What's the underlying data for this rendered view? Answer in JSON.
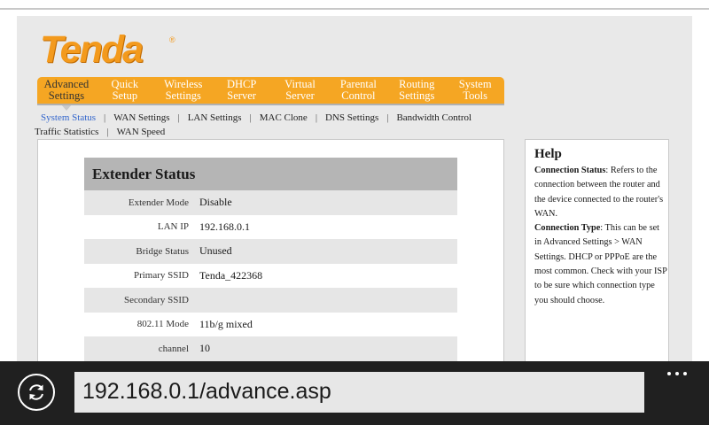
{
  "brand": {
    "logo_text": "Tenda",
    "logo_reg": "®",
    "accent": "#f5a623"
  },
  "menu": [
    {
      "label": "Advanced\nSettings",
      "active": true
    },
    {
      "label": "Quick\nSetup"
    },
    {
      "label": "Wireless\nSettings"
    },
    {
      "label": "DHCP\nServer"
    },
    {
      "label": "Virtual\nServer"
    },
    {
      "label": "Parental\nControl"
    },
    {
      "label": "Routing\nSettings"
    },
    {
      "label": "System\nTools"
    }
  ],
  "submenu": {
    "line1": [
      "System Status",
      "WAN Settings",
      "LAN Settings",
      "MAC Clone",
      "DNS Settings",
      "Bandwidth Control"
    ],
    "line2": [
      "Traffic Statistics",
      "WAN Speed"
    ],
    "active": "System Status"
  },
  "status": {
    "title": "Extender Status",
    "rows": [
      {
        "label": "Extender Mode",
        "value": "Disable"
      },
      {
        "label": "LAN IP",
        "value": "192.168.0.1"
      },
      {
        "label": "Bridge Status",
        "value": "Unused"
      },
      {
        "label": "Primary SSID",
        "value": "Tenda_422368"
      },
      {
        "label": "Secondary SSID",
        "value": ""
      },
      {
        "label": "802.11 Mode",
        "value": "11b/g mixed"
      },
      {
        "label": "channel",
        "value": "10"
      }
    ]
  },
  "help": {
    "title": "Help",
    "p1_term": "Connection Status",
    "p1_text": ": Refers to the connection between the router and the device connected to the router's WAN.",
    "p2_term": "Connection Type",
    "p2_text": ": This can be set in Advanced Settings > WAN Settings. DHCP or PPPoE are the most common. Check with your ISP to be sure which connection type you should choose."
  },
  "browser": {
    "url": "192.168.0.1/advance.asp",
    "refresh_icon": "refresh-icon",
    "more_icon": "more-options-icon"
  }
}
